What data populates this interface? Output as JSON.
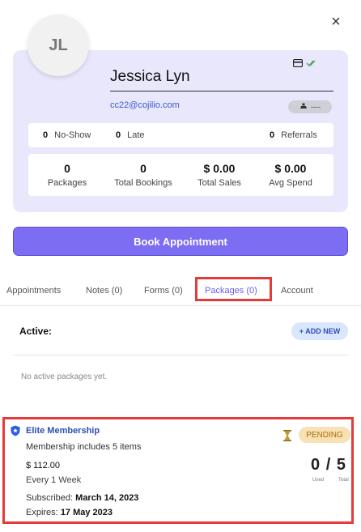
{
  "close_icon": "×",
  "profile": {
    "initials": "JL",
    "name": "Jessica Lyn",
    "email": "cc22@cojilio.com",
    "phone_placeholder": "----",
    "card_icon": "credit-card-icon",
    "verified_icon": "double-check-icon"
  },
  "counts": {
    "no_show": {
      "value": "0",
      "label": "No-Show"
    },
    "late": {
      "value": "0",
      "label": "Late"
    },
    "referrals": {
      "value": "0",
      "label": "Referrals"
    }
  },
  "stats": [
    {
      "value": "0",
      "label": "Packages"
    },
    {
      "value": "0",
      "label": "Total Bookings"
    },
    {
      "value": "$ 0.00",
      "label": "Total Sales"
    },
    {
      "value": "$ 0.00",
      "label": "Avg Spend"
    }
  ],
  "book_button": "Book Appointment",
  "tabs": [
    {
      "label": "Appointments"
    },
    {
      "label": "Notes (0)"
    },
    {
      "label": "Forms (0)"
    },
    {
      "label": "Packages (0)",
      "active": true
    },
    {
      "label": "Account"
    }
  ],
  "active_section": {
    "label": "Active:",
    "add_button": "+ ADD NEW",
    "empty_message": "No active packages yet."
  },
  "membership": {
    "title": "Elite Membership",
    "description": "Membership includes 5 items",
    "price": "$ 112.00",
    "frequency": "Every 1 Week",
    "subscribed_label": "Subscribed:",
    "subscribed_date": "March 14, 2023",
    "expires_label": "Expires:",
    "expires_date": "17 May 2023",
    "status": "PENDING",
    "used": "0",
    "separator": "/",
    "total": "5",
    "used_label": "Used",
    "total_label": "Total"
  },
  "colors": {
    "accent": "#7c6df2",
    "card_bg": "#e8e7fb",
    "highlight_border": "#e63a3a",
    "pending_bg": "#f8e1b4"
  }
}
